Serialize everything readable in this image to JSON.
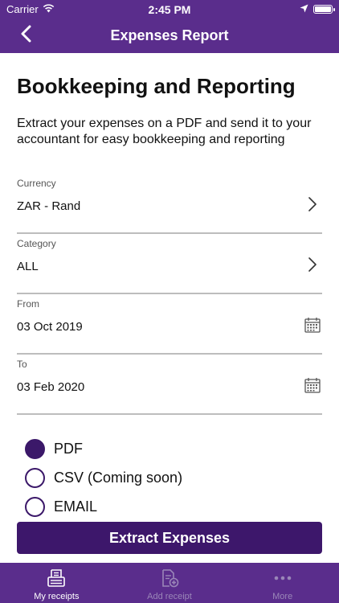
{
  "status_bar": {
    "carrier": "Carrier",
    "time": "2:45 PM"
  },
  "header": {
    "title": "Expenses Report",
    "back_icon": "chevron-left-icon"
  },
  "main": {
    "heading": "Bookkeeping and Reporting",
    "description": "Extract your expenses on a PDF and send it to your accountant for easy bookkeeping and reporting",
    "fields": {
      "currency": {
        "label": "Currency",
        "value": "ZAR - Rand",
        "icon": "chevron-right-icon"
      },
      "category": {
        "label": "Category",
        "value": "ALL",
        "icon": "chevron-right-icon"
      },
      "from": {
        "label": "From",
        "value": "03 Oct 2019",
        "icon": "calendar-icon"
      },
      "to": {
        "label": "To",
        "value": "03 Feb 2020",
        "icon": "calendar-icon"
      }
    },
    "format_options": [
      {
        "label": "PDF",
        "selected": true
      },
      {
        "label": "CSV (Coming soon)",
        "selected": false
      },
      {
        "label": "EMAIL",
        "selected": false
      }
    ],
    "extract_button": "Extract Expenses"
  },
  "tabbar": {
    "items": [
      {
        "label": "My receipts",
        "icon": "receipt-icon",
        "active": true
      },
      {
        "label": "Add receipt",
        "icon": "add-receipt-icon",
        "active": false
      },
      {
        "label": "More",
        "icon": "more-icon",
        "active": false
      }
    ]
  },
  "colors": {
    "primary": "#5a2d8c",
    "accent": "#3d176b",
    "divider": "#bdbdbd",
    "inactive_tab": "#9a86b8"
  }
}
